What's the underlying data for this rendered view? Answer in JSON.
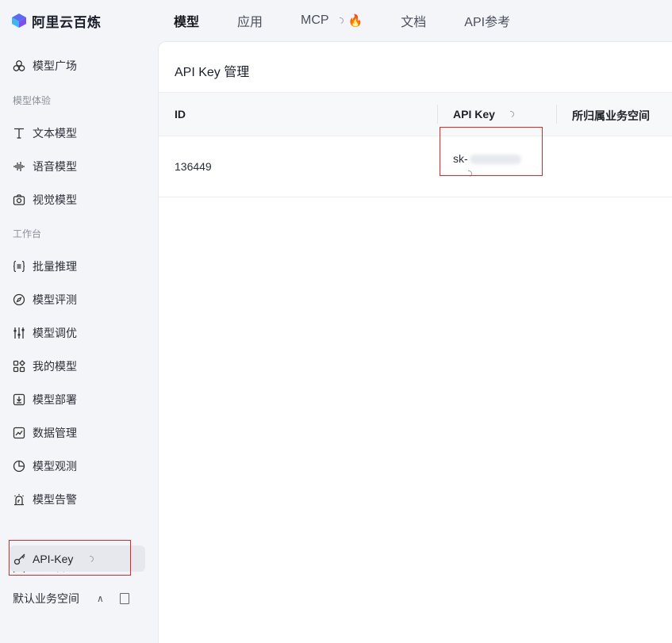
{
  "brand": {
    "name": "阿里云百炼",
    "logo_icon": "bailian-logo-icon"
  },
  "topnav": {
    "items": [
      {
        "label": "模型",
        "active": true
      },
      {
        "label": "应用",
        "active": false
      },
      {
        "label": "MCP",
        "active": false
      },
      {
        "label": "文档",
        "active": false
      },
      {
        "label": "API参考",
        "active": false
      }
    ]
  },
  "sidebar": {
    "model_square": "模型广场",
    "section_experience": "模型体验",
    "text_model": "文本模型",
    "voice_model": "语音模型",
    "vision_model": "视觉模型",
    "section_workbench": "工作台",
    "batch_inference": "批量推理",
    "model_eval": "模型评测",
    "model_tuning": "模型调优",
    "my_models": "我的模型",
    "model_deploy": "模型部署",
    "data_manage": "数据管理",
    "model_observe": "模型观测",
    "model_alert": "模型告警",
    "system_manage": "系统管理",
    "api_key": "API-Key",
    "workspace": "默认业务空间"
  },
  "main": {
    "title": "API Key 管理",
    "columns": [
      "ID",
      "API Key",
      "所归属业务空间"
    ],
    "rows": [
      {
        "id": "136449",
        "key_prefix": "sk-"
      }
    ]
  },
  "colors": {
    "highlight_box": "#e02a2a",
    "fire": "#ff6a1a"
  }
}
